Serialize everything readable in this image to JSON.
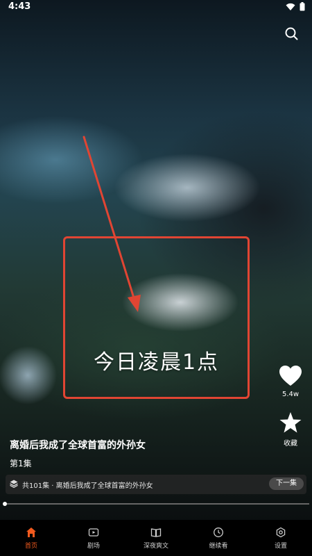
{
  "status_bar": {
    "time": "4:43"
  },
  "video": {
    "subtitle": "今日凌晨1点",
    "like_count": "5.4w",
    "favorite_label": "收藏"
  },
  "drama": {
    "title": "离婚后我成了全球首富的外孙女",
    "episode": "第1集",
    "series_info": "共101集 · 离婚后我成了全球首富的外孙女",
    "next_label": "下一集"
  },
  "progress": {
    "fraction": 0.0
  },
  "tabs": [
    {
      "label": "首页",
      "icon": "home-icon",
      "active": true
    },
    {
      "label": "剧场",
      "icon": "theater-icon",
      "active": false
    },
    {
      "label": "深夜爽文",
      "icon": "book-icon",
      "active": false
    },
    {
      "label": "继续看",
      "icon": "clock-icon",
      "active": false
    },
    {
      "label": "设置",
      "icon": "settings-icon",
      "active": false
    }
  ],
  "colors": {
    "accent": "#f25a1e",
    "annotation": "#e14533"
  }
}
